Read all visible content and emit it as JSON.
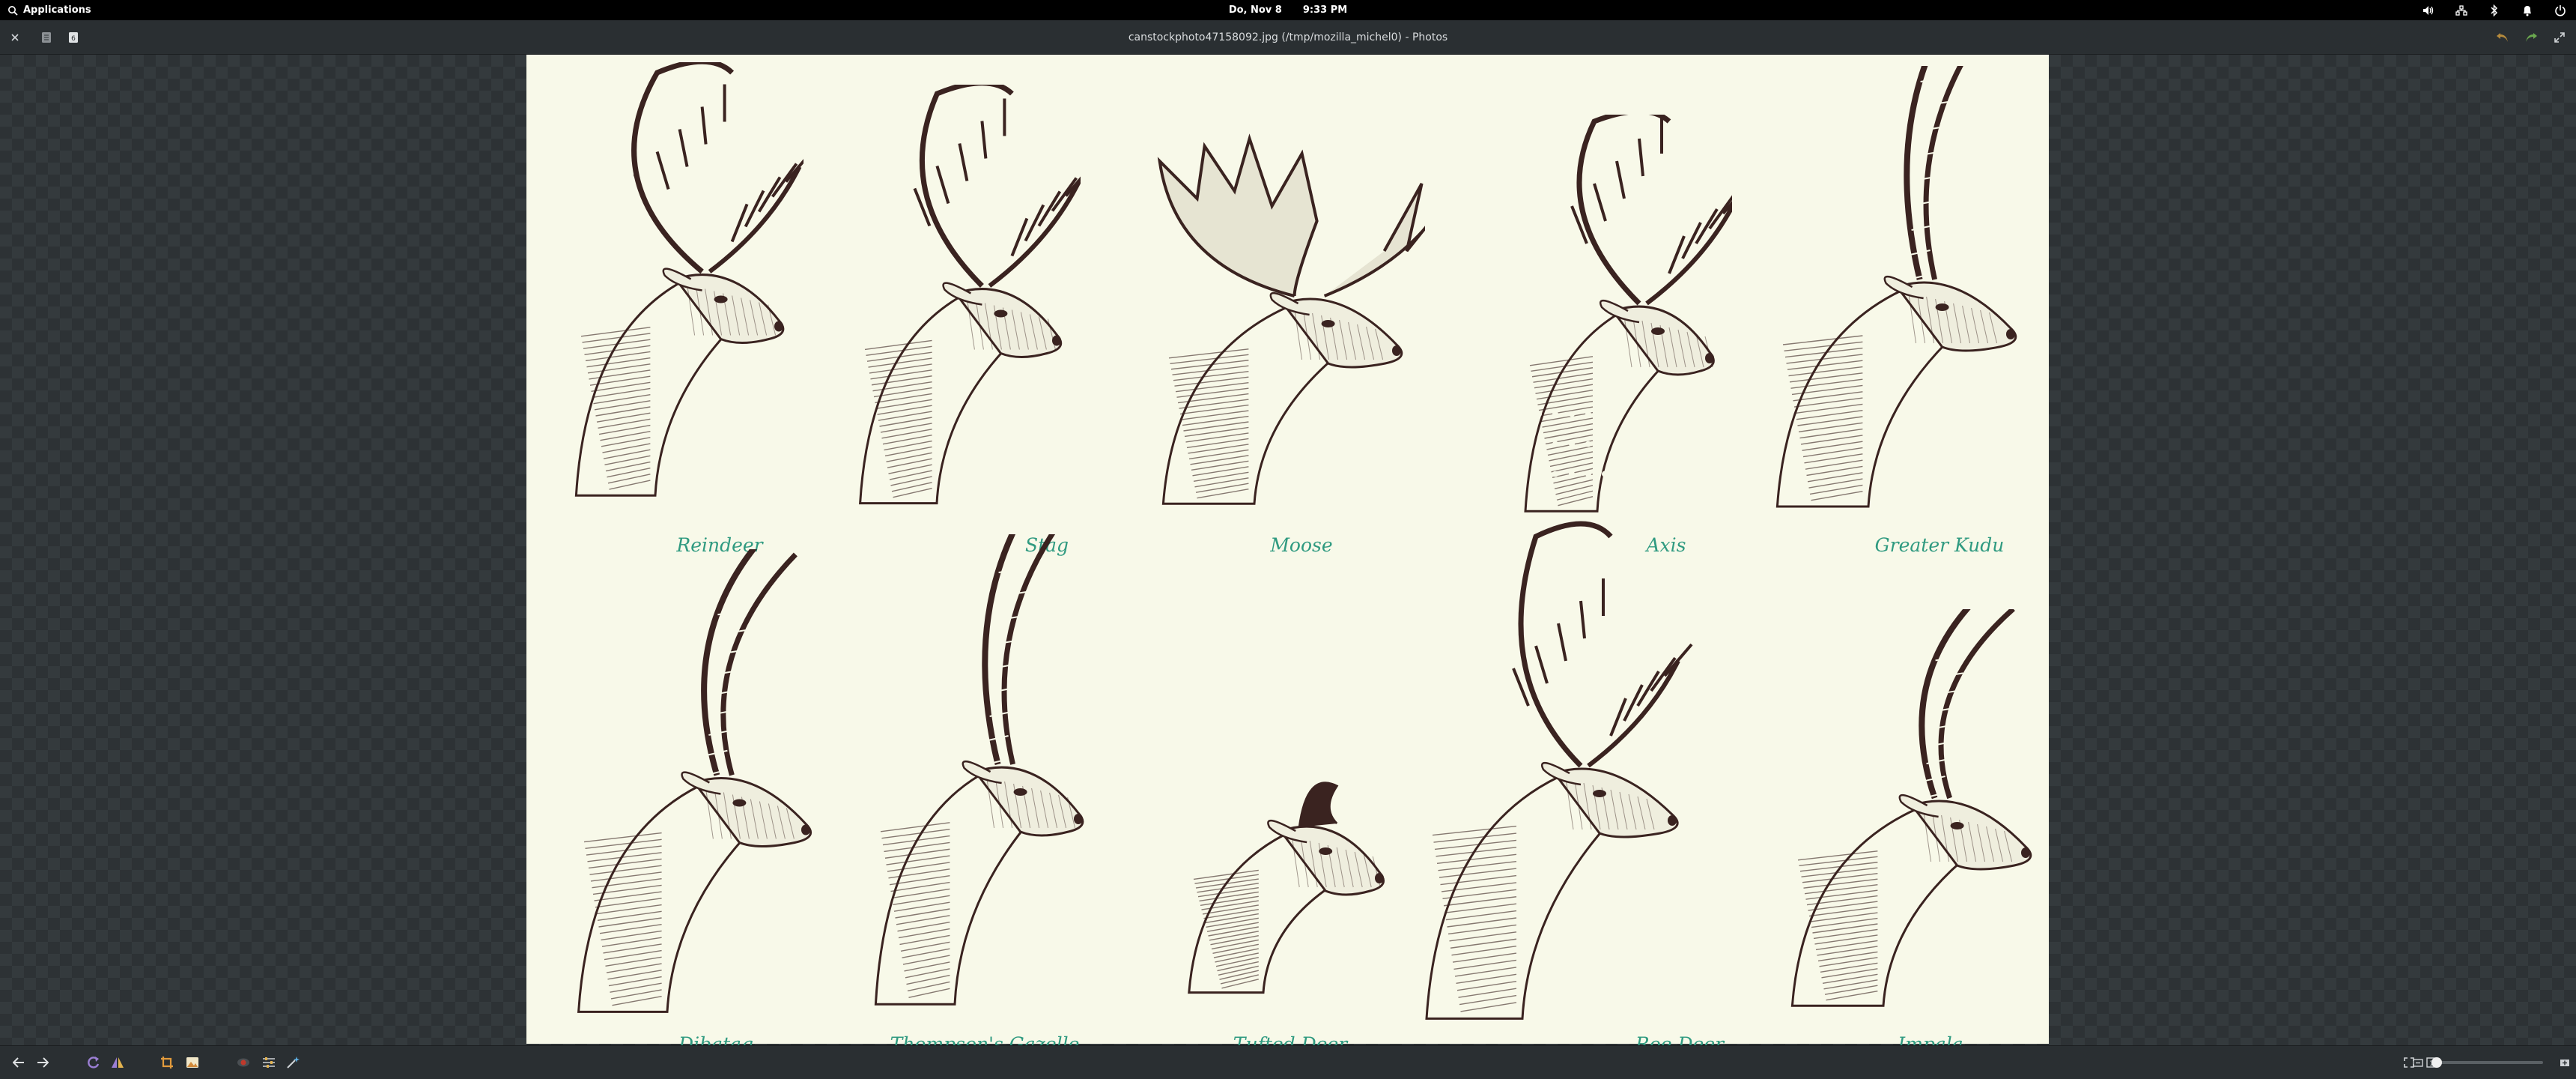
{
  "panel": {
    "applications_label": "Applications",
    "date": "Do, Nov  8",
    "time": "9:33 PM",
    "indicators": [
      "volume-icon",
      "network-icon",
      "bluetooth-icon",
      "notifications-icon",
      "power-icon"
    ]
  },
  "header": {
    "title": "canstockphoto47158092.jpg (/tmp/mozilla_michel0) - Photos",
    "left_buttons": [
      "close-icon",
      "view-info-icon",
      "view-badge-icon"
    ],
    "right_buttons": [
      "undo-icon",
      "redo-icon",
      "fullscreen-icon"
    ],
    "undo_color": "#b58a3c",
    "redo_color": "#6aa84f"
  },
  "photo": {
    "background": "#f8f9e9",
    "label_color": "#2f9a80",
    "ink_color": "#3a2320",
    "animals": [
      {
        "name": "Reindeer"
      },
      {
        "name": "Stag"
      },
      {
        "name": "Moose"
      },
      {
        "name": "Axis"
      },
      {
        "name": "Greater Kudu"
      },
      {
        "name": "Dibatag"
      },
      {
        "name": "Thompson's Gazelle"
      },
      {
        "name": "Tufted Deer"
      },
      {
        "name": "Roe Deer"
      },
      {
        "name": "Impala"
      }
    ]
  },
  "toolbar": {
    "buttons": [
      "previous-icon",
      "next-icon",
      "rotate-icon",
      "flip-icon",
      "crop-icon",
      "image-icon",
      "red-eye-icon",
      "adjust-icon",
      "enhance-icon"
    ],
    "right_buttons": [
      "fit-window-icon",
      "zoom-actual-icon",
      "zoom-out-icon",
      "zoom-in-icon"
    ],
    "zoom_level": 0.05
  }
}
